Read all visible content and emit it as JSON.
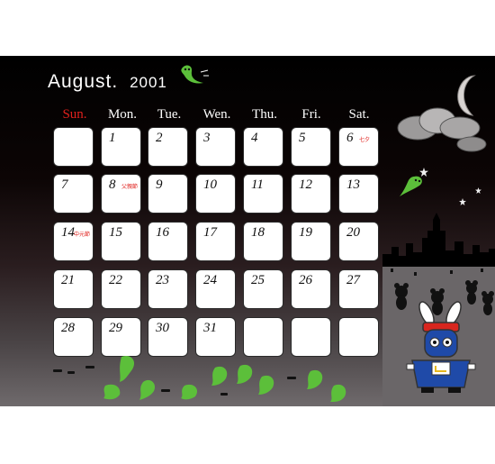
{
  "calendar": {
    "month": "August.",
    "year": "2001",
    "weekdays": [
      "Sun.",
      "Mon.",
      "Tue.",
      "Wen.",
      "Thu.",
      "Fri.",
      "Sat."
    ],
    "weeks": [
      [
        {
          "d": ""
        },
        {
          "d": "1"
        },
        {
          "d": "2"
        },
        {
          "d": "3"
        },
        {
          "d": "4"
        },
        {
          "d": "5"
        },
        {
          "d": "6",
          "note": "七夕"
        }
      ],
      [
        {
          "d": "7"
        },
        {
          "d": "8",
          "note": "父親節"
        },
        {
          "d": "9"
        },
        {
          "d": "10"
        },
        {
          "d": "11"
        },
        {
          "d": "12"
        },
        {
          "d": "13"
        }
      ],
      [
        {
          "d": "14",
          "note": "中元節"
        },
        {
          "d": "15"
        },
        {
          "d": "16"
        },
        {
          "d": "17"
        },
        {
          "d": "18"
        },
        {
          "d": "19"
        },
        {
          "d": "20"
        }
      ],
      [
        {
          "d": "21"
        },
        {
          "d": "22"
        },
        {
          "d": "23"
        },
        {
          "d": "24"
        },
        {
          "d": "25"
        },
        {
          "d": "26"
        },
        {
          "d": "27"
        }
      ],
      [
        {
          "d": "28"
        },
        {
          "d": "29"
        },
        {
          "d": "30"
        },
        {
          "d": "31"
        },
        {
          "d": ""
        },
        {
          "d": ""
        },
        {
          "d": ""
        }
      ]
    ]
  },
  "colors": {
    "sunday": "#e0201c",
    "note": "#e0201c",
    "ghost": "#5cbf3a"
  },
  "decorations": [
    "ghost-icon",
    "crescent-moon-icon",
    "cloud-icon",
    "star-icon",
    "city-skyline",
    "bunny-jiangshi-mascot",
    "mouse-silhouettes"
  ]
}
